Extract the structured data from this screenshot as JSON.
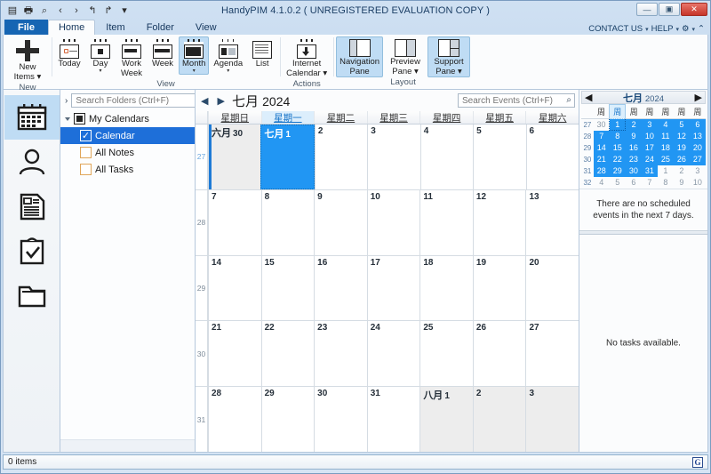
{
  "window": {
    "title": "HandyPIM 4.1.0.2 ( UNREGISTERED EVALUATION COPY )",
    "minimize": "—",
    "maximize": "▣",
    "close": "✕"
  },
  "quick_access": [
    {
      "name": "calendar-icon",
      "glyph": "▤"
    },
    {
      "name": "print-icon",
      "glyph": "🖶"
    },
    {
      "name": "print-preview-icon",
      "glyph": "⌕"
    },
    {
      "name": "back-icon",
      "glyph": "‹"
    },
    {
      "name": "forward-icon",
      "glyph": "›"
    },
    {
      "name": "undo-icon",
      "glyph": "↰"
    },
    {
      "name": "redo-icon",
      "glyph": "↱"
    },
    {
      "name": "customize-icon",
      "glyph": "▾"
    }
  ],
  "tabs": [
    {
      "label": "File",
      "active": false,
      "file": true
    },
    {
      "label": "Home",
      "active": true
    },
    {
      "label": "Item",
      "active": false
    },
    {
      "label": "Folder",
      "active": false
    },
    {
      "label": "View",
      "active": false
    }
  ],
  "tab_right": {
    "contact_us": "CONTACT US",
    "help": "HELP",
    "settings_icon": "⚙",
    "collapse_icon": "⌃"
  },
  "ribbon": {
    "groups": [
      {
        "label": "New",
        "buttons": [
          {
            "label": "New\nItems",
            "line1": "New",
            "line2": "Items",
            "icon": "plus-icon",
            "dropdown": true,
            "selected": false
          }
        ]
      },
      {
        "label": "View",
        "buttons": [
          {
            "line1": "Today",
            "line2": "",
            "icon": "today-icon",
            "dropdown": false,
            "selected": false
          },
          {
            "line1": "Day",
            "line2": "",
            "icon": "day-icon",
            "dropdown": true,
            "selected": false
          },
          {
            "line1": "Work",
            "line2": "Week",
            "icon": "work-week-icon",
            "dropdown": false,
            "selected": false
          },
          {
            "line1": "Week",
            "line2": "",
            "icon": "week-icon",
            "dropdown": false,
            "selected": false
          },
          {
            "line1": "Month",
            "line2": "",
            "icon": "month-icon",
            "dropdown": true,
            "selected": true
          },
          {
            "line1": "Agenda",
            "line2": "",
            "icon": "agenda-icon",
            "dropdown": true,
            "selected": false
          },
          {
            "line1": "List",
            "line2": "",
            "icon": "list-icon",
            "dropdown": false,
            "selected": false
          }
        ]
      },
      {
        "label": "Actions",
        "buttons": [
          {
            "line1": "Internet",
            "line2": "Calendar",
            "icon": "internet-calendar-icon",
            "dropdown": true,
            "selected": false
          }
        ]
      },
      {
        "label": "Layout",
        "buttons": [
          {
            "line1": "Navigation",
            "line2": "Pane",
            "icon": "navigation-pane-icon",
            "dropdown": false,
            "selected": true
          },
          {
            "line1": "Preview",
            "line2": "Pane",
            "icon": "preview-pane-icon",
            "dropdown": true,
            "selected": false
          },
          {
            "line1": "Support",
            "line2": "Pane",
            "icon": "support-pane-icon",
            "dropdown": true,
            "selected": true
          }
        ]
      }
    ]
  },
  "icon_bar": [
    {
      "name": "sidebar-calendar",
      "icon": "calendar-icon",
      "active": true
    },
    {
      "name": "sidebar-contacts",
      "icon": "person-icon",
      "active": false
    },
    {
      "name": "sidebar-notes",
      "icon": "note-icon",
      "active": false
    },
    {
      "name": "sidebar-tasks",
      "icon": "clipboard-check-icon",
      "active": false
    },
    {
      "name": "sidebar-folders",
      "icon": "folder-icon",
      "active": false
    }
  ],
  "nav_pane": {
    "search_placeholder": "Search Folders (Ctrl+F)",
    "search_value": "",
    "expand_icon": "›",
    "root": {
      "label": "My Calendars",
      "checkbox": "partial"
    },
    "folders": [
      {
        "label": "Calendar",
        "checked": true,
        "selected": true
      },
      {
        "label": "All Notes",
        "checked": false,
        "selected": false
      },
      {
        "label": "All Tasks",
        "checked": false,
        "selected": false
      }
    ]
  },
  "calendar": {
    "prev_icon": "◀",
    "next_icon": "▶",
    "month_label": "七月",
    "year_label": "2024",
    "search_placeholder": "Search Events (Ctrl+F)",
    "search_value": "",
    "search_icon": "search-icon",
    "day_headers": [
      {
        "label": "星期日",
        "highlight": false
      },
      {
        "label": "星期一",
        "highlight": true
      },
      {
        "label": "星期二",
        "highlight": false
      },
      {
        "label": "星期三",
        "highlight": false
      },
      {
        "label": "星期四",
        "highlight": false
      },
      {
        "label": "星期五",
        "highlight": false
      },
      {
        "label": "星期六",
        "highlight": false
      }
    ],
    "weeks": [
      {
        "week_number": "27",
        "highlight_week": true,
        "days": [
          {
            "num": "30",
            "month_prefix": "六月",
            "other": true,
            "selected": false,
            "today_bar": true
          },
          {
            "num": "1",
            "month_prefix": "七月",
            "other": false,
            "selected": true
          },
          {
            "num": "2",
            "other": false,
            "selected": false
          },
          {
            "num": "3",
            "other": false,
            "selected": false
          },
          {
            "num": "4",
            "other": false,
            "selected": false
          },
          {
            "num": "5",
            "other": false,
            "selected": false
          },
          {
            "num": "6",
            "other": false,
            "selected": false
          }
        ]
      },
      {
        "week_number": "28",
        "highlight_week": false,
        "days": [
          {
            "num": "7"
          },
          {
            "num": "8"
          },
          {
            "num": "9"
          },
          {
            "num": "10"
          },
          {
            "num": "11"
          },
          {
            "num": "12"
          },
          {
            "num": "13"
          }
        ]
      },
      {
        "week_number": "29",
        "highlight_week": false,
        "days": [
          {
            "num": "14"
          },
          {
            "num": "15"
          },
          {
            "num": "16"
          },
          {
            "num": "17"
          },
          {
            "num": "18"
          },
          {
            "num": "19"
          },
          {
            "num": "20"
          }
        ]
      },
      {
        "week_number": "30",
        "highlight_week": false,
        "days": [
          {
            "num": "21"
          },
          {
            "num": "22"
          },
          {
            "num": "23"
          },
          {
            "num": "24"
          },
          {
            "num": "25"
          },
          {
            "num": "26"
          },
          {
            "num": "27"
          }
        ]
      },
      {
        "week_number": "31",
        "highlight_week": false,
        "days": [
          {
            "num": "28"
          },
          {
            "num": "29"
          },
          {
            "num": "30"
          },
          {
            "num": "31"
          },
          {
            "num": "1",
            "month_prefix": "八月",
            "other": true
          },
          {
            "num": "2",
            "other": true
          },
          {
            "num": "3",
            "other": true
          }
        ]
      }
    ]
  },
  "support_pane": {
    "mini_calendar": {
      "prev_icon": "◀",
      "next_icon": "▶",
      "month_label": "七月",
      "year_label": "2024",
      "day_headers": [
        {
          "label": "周",
          "highlight": false
        },
        {
          "label": "周",
          "highlight": true
        },
        {
          "label": "周",
          "highlight": false
        },
        {
          "label": "周",
          "highlight": false
        },
        {
          "label": "周",
          "highlight": false
        },
        {
          "label": "周",
          "highlight": false
        },
        {
          "label": "周",
          "highlight": false
        }
      ],
      "rows": [
        {
          "wk": "27",
          "days": [
            {
              "n": "30",
              "state": "dim"
            },
            {
              "n": "1",
              "state": "on first"
            },
            {
              "n": "2",
              "state": "on"
            },
            {
              "n": "3",
              "state": "on"
            },
            {
              "n": "4",
              "state": "on"
            },
            {
              "n": "5",
              "state": "on"
            },
            {
              "n": "6",
              "state": "on"
            }
          ]
        },
        {
          "wk": "28",
          "days": [
            {
              "n": "7",
              "state": "on"
            },
            {
              "n": "8",
              "state": "on"
            },
            {
              "n": "9",
              "state": "on"
            },
            {
              "n": "10",
              "state": "on"
            },
            {
              "n": "11",
              "state": "on"
            },
            {
              "n": "12",
              "state": "on"
            },
            {
              "n": "13",
              "state": "on"
            }
          ]
        },
        {
          "wk": "29",
          "days": [
            {
              "n": "14",
              "state": "on"
            },
            {
              "n": "15",
              "state": "on"
            },
            {
              "n": "16",
              "state": "on"
            },
            {
              "n": "17",
              "state": "on"
            },
            {
              "n": "18",
              "state": "on"
            },
            {
              "n": "19",
              "state": "on"
            },
            {
              "n": "20",
              "state": "on"
            }
          ]
        },
        {
          "wk": "30",
          "days": [
            {
              "n": "21",
              "state": "on"
            },
            {
              "n": "22",
              "state": "on"
            },
            {
              "n": "23",
              "state": "on"
            },
            {
              "n": "24",
              "state": "on"
            },
            {
              "n": "25",
              "state": "on"
            },
            {
              "n": "26",
              "state": "on"
            },
            {
              "n": "27",
              "state": "on"
            }
          ]
        },
        {
          "wk": "31",
          "days": [
            {
              "n": "28",
              "state": "on"
            },
            {
              "n": "29",
              "state": "on"
            },
            {
              "n": "30",
              "state": "on"
            },
            {
              "n": "31",
              "state": "on"
            },
            {
              "n": "1",
              "state": "dim"
            },
            {
              "n": "2",
              "state": "dim"
            },
            {
              "n": "3",
              "state": "dim"
            }
          ]
        },
        {
          "wk": "32",
          "days": [
            {
              "n": "4",
              "state": "dim"
            },
            {
              "n": "5",
              "state": "dim"
            },
            {
              "n": "6",
              "state": "dim"
            },
            {
              "n": "7",
              "state": "dim"
            },
            {
              "n": "8",
              "state": "dim"
            },
            {
              "n": "9",
              "state": "dim"
            },
            {
              "n": "10",
              "state": "dim"
            }
          ]
        }
      ]
    },
    "events_message": "There are no scheduled events in the next 7 days.",
    "tasks_message": "No tasks available."
  },
  "status_bar": {
    "items_text": "0 items",
    "logo": "G"
  },
  "colors": {
    "accent": "#2196f3",
    "selection": "#1e6fd9",
    "file_tab": "#1665b3",
    "ribbon_selected": "#bfdcf4"
  }
}
